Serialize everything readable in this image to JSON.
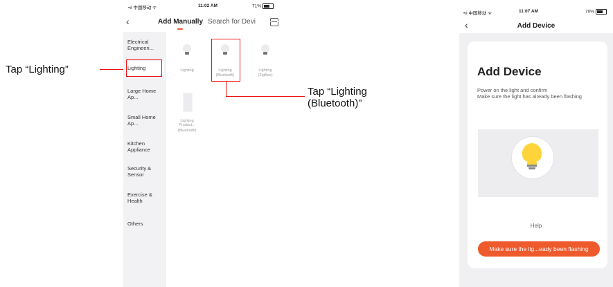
{
  "screen1": {
    "status": {
      "signal": "•ıl 中国移动 ᯤ",
      "time": "11:02 AM",
      "battery": "71%"
    },
    "nav": {
      "back": "‹",
      "tab_active": "Add Manually",
      "tab_other": "Search for Devi"
    },
    "categories": [
      {
        "label": "Electrical Engineeri..."
      },
      {
        "label": "Lighting"
      },
      {
        "label": "Large Home Ap..."
      },
      {
        "label": "Small Home Ap..."
      },
      {
        "label": "Kitchen Appliance"
      },
      {
        "label": "Security & Sensor"
      },
      {
        "label": "Exercise & Health"
      },
      {
        "label": "Others"
      }
    ],
    "devices": [
      {
        "label": "Lighting",
        "sub": ""
      },
      {
        "label": "Lighting",
        "sub": "(Bluetooth)"
      },
      {
        "label": "Lighting",
        "sub": "(ZigBee)"
      },
      {
        "label": "Lighting Product...",
        "sub": "(Bluetooth)"
      }
    ]
  },
  "callouts": {
    "tap_lighting": "Tap “Lighting”",
    "tap_bluetooth_line1": "Tap “Lighting",
    "tap_bluetooth_line2": "(Bluetooth)”"
  },
  "screen2": {
    "status": {
      "signal": "•ıl 中国移动 ᯤ",
      "time": "11:07 AM",
      "battery": "70%"
    },
    "nav": {
      "back": "‹",
      "title": "Add Device"
    },
    "heading": "Add Device",
    "desc_line1": "Power on the light and confirm",
    "desc_line2": "Make sure the light has already been flashing",
    "help": "Help",
    "button": "Make sure the lig...eady been flashing"
  },
  "colors": {
    "accent": "#ee5a2c",
    "highlight": "#e11111",
    "bulb": "#ffd43b"
  }
}
